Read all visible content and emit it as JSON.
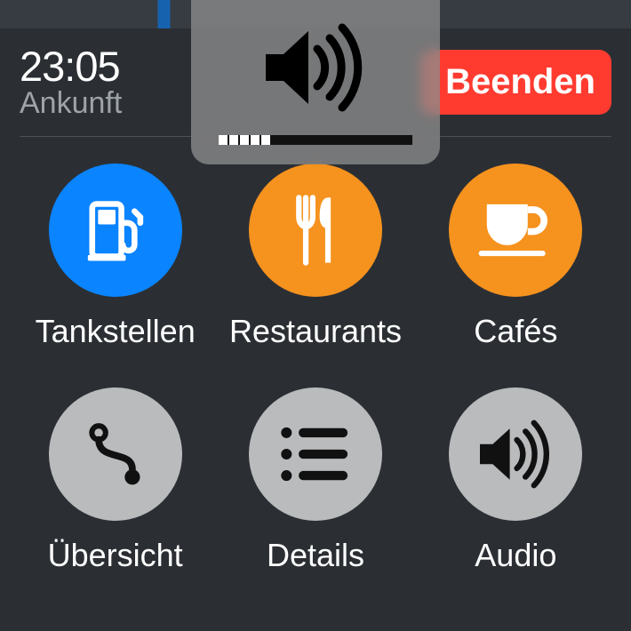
{
  "arrival": {
    "time": "23:05",
    "label": "Ankunft"
  },
  "end_button_label": "Beenden",
  "categories": [
    {
      "label": "Tankstellen"
    },
    {
      "label": "Restaurants"
    },
    {
      "label": "Cafés"
    }
  ],
  "actions": [
    {
      "label": "Übersicht"
    },
    {
      "label": "Details"
    },
    {
      "label": "Audio"
    }
  ],
  "volume": {
    "segments_filled": 5,
    "segments_total": 18
  },
  "colors": {
    "blue": "#0a84ff",
    "orange": "#f6921e",
    "gray": "#b9bbbd",
    "red": "#ff3b30",
    "bg": "#2b2f34"
  }
}
